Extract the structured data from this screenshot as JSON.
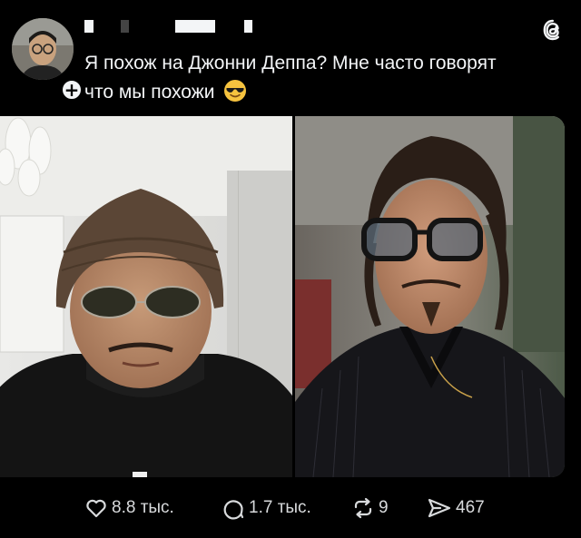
{
  "post": {
    "username": "",
    "text_line1": "Я похож на Джонни Деппа? Мне часто говорят",
    "text_line2": "что мы похожи",
    "emoji": "smiling-face-with-sunglasses",
    "follow_symbol": "+"
  },
  "media": {
    "left_image": "selfie of man in brown knit beanie and round sunglasses",
    "right_image": "portrait of Johnny Depp with tinted glasses"
  },
  "actions": {
    "likes": "8.8 тыс.",
    "replies": "1.7 тыс.",
    "reposts": "9",
    "shares": "467"
  },
  "icons": {
    "like": "heart-icon",
    "reply": "comment-icon",
    "repost": "repost-icon",
    "share": "send-icon",
    "brand": "threads-logo-icon"
  },
  "colors": {
    "background": "#000000",
    "text": "#f3f5f7",
    "muted": "#d8dadc"
  }
}
